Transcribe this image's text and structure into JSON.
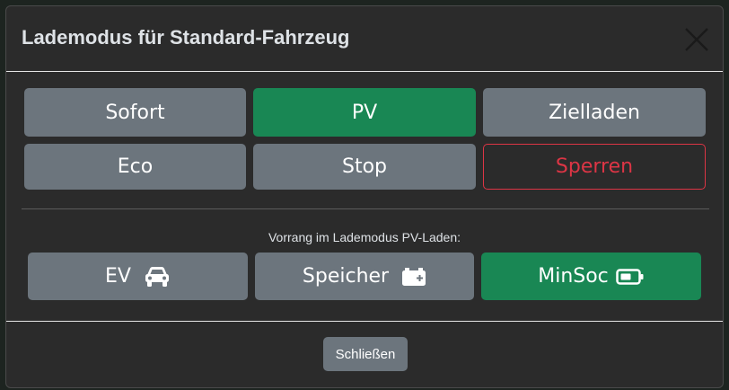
{
  "modal": {
    "title": "Lademodus für Standard-Fahrzeug",
    "close_icon": "close-icon"
  },
  "modes": {
    "sofort": "Sofort",
    "pv": "PV",
    "zielladen": "Zielladen",
    "eco": "Eco",
    "stop": "Stop",
    "sperren": "Sperren",
    "selected": "PV"
  },
  "priority": {
    "label": "Vorrang im Lademodus PV-Laden:",
    "ev": "EV",
    "ev_icon": "car-icon",
    "speicher": "Speicher",
    "speicher_icon": "battery-plus-icon",
    "minsoc": "MinSoc",
    "minsoc_icon": "battery-half-icon",
    "selected": "MinSoc"
  },
  "footer": {
    "close_label": "Schließen"
  },
  "colors": {
    "success": "#198754",
    "secondary": "#6c757d",
    "danger": "#dc3545",
    "modal_bg": "#2b2b2b"
  }
}
